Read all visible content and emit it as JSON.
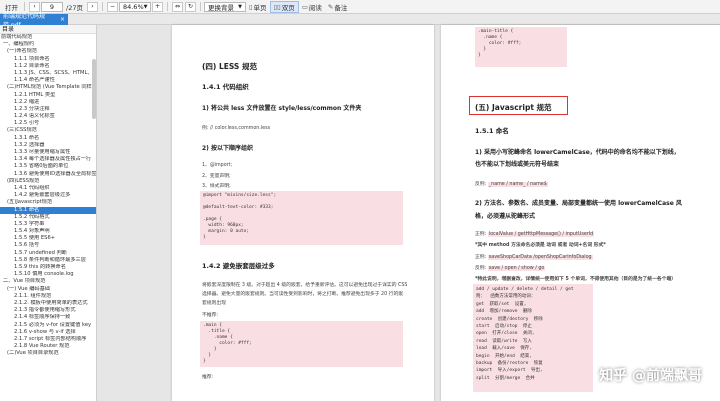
{
  "toolbar": {
    "open": "打开",
    "current_page": "9",
    "total_pages": "/27页",
    "zoom": "84.6%",
    "bg_label": "更换背景",
    "single_page": "单页",
    "double_page": "双页",
    "read": "阅读",
    "note": "备注"
  },
  "tab": {
    "title": "前端规范代码规范.pdf",
    "close": "×"
  },
  "sidebar": {
    "header": "目录",
    "items": [
      "前端代码规范",
      "一、编程规约",
      "(一)命名规范",
      "1.1.1 项目命名",
      "1.1.2 目录命名",
      "1.1.3 JS、CSS、SCSS、HTML、P",
      "1.1.4 命名严谨性",
      "(二)HTML规范 (Vue Template 同样",
      "1.2.1 HTML 类型",
      "1.2.2 缩进",
      "1.2.3 分块注释",
      "1.2.4 语义化标签",
      "1.2.5 引号",
      "(三)CSS规范",
      "1.3.1 命名",
      "1.3.2 选择器",
      "1.3.3 尽量使用缩写属性",
      "1.3.4 每个选择器及属性独占一行",
      "1.3.5 省略0后面的单位",
      "1.3.6 避免使用ID选择器及全局标签",
      "(四)LESS规范",
      "1.4.1 代码组织",
      "1.4.2 避免嵌套层级过多",
      "(五)Javascript规范",
      "1.5.1 命名",
      "1.5.2 代码格式",
      "1.5.3 字符串",
      "1.5.4 对象声明",
      "1.5.5 使用 ES6+",
      "1.5.6 括号",
      "1.5.7 undefined 判断",
      "1.5.8 条件判断和循环最多三层",
      "1.5.9 this 的转换命名",
      "1.5.10 慎用 console.log",
      "二、Vue 项目规范",
      "(一) Vue 编码基础",
      "2.1.1. 组件规范",
      "2.1.2. 模板中使用简单的表达式",
      "2.1.3 指令都使用缩写形式",
      "2.1.4 标签顺序保持一致",
      "2.1.5 必须为 v-for 设置键值 key",
      "2.1.6 v-show 与 v-if 选择",
      "2.1.7 script 标签内部结构顺序",
      "2.1.8 Vue Router 规范",
      "(二)Vue 项目目录规范"
    ],
    "selected_index": 24
  },
  "page1": {
    "section_title": "(四)  LESS 规范",
    "s141": "1.4.1  代码组织",
    "item1": "1)  将公共 less 文件放置在 style/less/common 文件夹",
    "item1_example": "例: // color.less,common.less",
    "item2": "2)  按以下顺序组织",
    "order": [
      "1、@import;",
      "2、变量声明;",
      "3、样式声明;"
    ],
    "code1": "@import \"mixins/size.less\";\n\n@default-text-color: #333;\n\n.page {\n  width: 960px;\n  margin: 0 auto;\n}",
    "s142": "1.4.2  避免嵌套层级过多",
    "para1": "将嵌套深度限制在 3 级。对于超出 4 级的嵌套，给予重新评估。这可以避免出现过于详实的 CSS",
    "para2": "选择器。避免大量的嵌套规则。当可读性受到影响时，将之打断。推荐避免出现多于 20 行的嵌",
    "para3": "套规则出现",
    "bad": "不推荐:",
    "code2": ".main {\n  .title {\n    .name {\n      color: #fff;\n    }\n  }\n}",
    "good": "推荐:"
  },
  "page2": {
    "code_top": ".main-title {\n  .name {\n    color: #fff;\n  }\n}",
    "section_title": "(五)  Javascript 规范",
    "s151": "1.5.1  命名",
    "item1a": "1)  采用小写驼峰命名 lowerCamelCase，代码中的命名均不能以下划线，",
    "item1b": "也不能以下划线或美元符号结束",
    "ex1_label": "反例:",
    "ex1_value": "_name / name_ / name$",
    "item2a": "2)  方法名、参数名、成员变量、局部变量都统一使用 lowerCamelCase 风",
    "item2b": "格，必须遵从驼峰形式",
    "ex2_label": "正例:",
    "ex2_value": "localValue / getHttpMessage() / inputUserId",
    "note": "*其中 method 方法命名必须是 动词 或者 动词+名词 形式*",
    "ex3_label": "正例:",
    "ex3_value": "saveShopCarData /openShopCarInfoDialog",
    "ex4_label": "反例:",
    "ex4_value": "save / open / show / go",
    "note2": "*特此说明，增删查改，详情统一使用如下 5 个单词，不得使用其他（目的是为了统一各个端）",
    "code3": "add / update / delete / detail / get\n附：  函数方法常用的动词：\nget  获取/set  设置,\nadd  增加/remove  删除\ncreate  创建/destory  移除\nstart  启动/stop  停止\nopen  打开/close  关闭,\nread  读取/write  写入\nload  载入/save  保存,\nbegin  开始/end  结束,\nbackup  备份/restore  恢复\nimport  导入/export  导出,\nsplit  分割/merge  合并"
  },
  "watermark": "知乎 @前端飘哥"
}
